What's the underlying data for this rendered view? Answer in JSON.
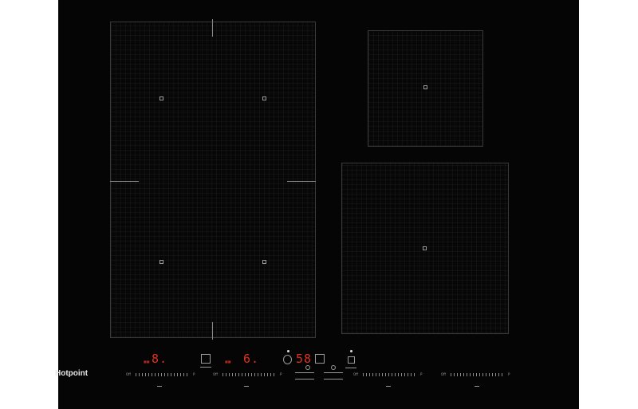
{
  "brand": {
    "logo_text": "Hotpoint"
  },
  "displays": {
    "left_zone_level": "8.",
    "center_zone_level": "6.",
    "timer_value": "58"
  },
  "sliders": [
    {
      "name": "slider-zone-1",
      "min_label": "Off",
      "max_label": "P"
    },
    {
      "name": "slider-zone-2",
      "min_label": "Off",
      "max_label": "P"
    },
    {
      "name": "slider-zone-3",
      "min_label": "Off",
      "max_label": "P"
    },
    {
      "name": "slider-zone-4",
      "min_label": "Off",
      "max_label": "P"
    }
  ],
  "colors": {
    "glass": "#050505",
    "display_red": "#e0301e",
    "zone_outline": "#3a3a3a",
    "page_background": "#ffffff"
  },
  "icons": [
    "clock-icon",
    "lock-icon",
    "bridge-icon",
    "pause-icon",
    "power-icon"
  ]
}
